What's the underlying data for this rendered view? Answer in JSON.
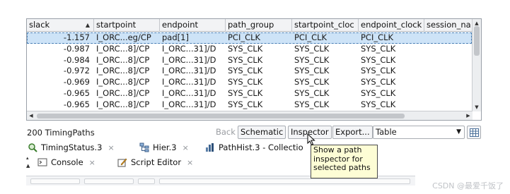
{
  "table": {
    "columns": [
      {
        "label": "slack",
        "width": 95
      },
      {
        "label": "startpoint",
        "width": 93
      },
      {
        "label": "endpoint",
        "width": 93
      },
      {
        "label": "path_group",
        "width": 94
      },
      {
        "label": "startpoint_cloc",
        "width": 94
      },
      {
        "label": "endpoint_clock",
        "width": 93
      },
      {
        "label": "session_na",
        "width": 67
      }
    ],
    "sorted_column": "slack",
    "sort_indicator": "^",
    "rows": [
      {
        "slack": "-1.157",
        "startpoint": "I_ORC...eg/CP",
        "endpoint": "pad[1]",
        "path_group": "PCI_CLK",
        "startpoint_clock": "PCI_CLK",
        "endpoint_clock": "PCI_CLK",
        "session": ""
      },
      {
        "slack": "-0.987",
        "startpoint": "I_ORC...8]/CP",
        "endpoint": "I_ORC...31]/D",
        "path_group": "SYS_CLK",
        "startpoint_clock": "SYS_CLK",
        "endpoint_clock": "SYS_CLK",
        "session": ""
      },
      {
        "slack": "-0.984",
        "startpoint": "I_ORC...8]/CP",
        "endpoint": "I_ORC...31]/D",
        "path_group": "SYS_CLK",
        "startpoint_clock": "SYS_CLK",
        "endpoint_clock": "SYS_CLK",
        "session": ""
      },
      {
        "slack": "-0.972",
        "startpoint": "I_ORC...8]/CP",
        "endpoint": "I_ORC...31]/D",
        "path_group": "SYS_CLK",
        "startpoint_clock": "SYS_CLK",
        "endpoint_clock": "SYS_CLK",
        "session": ""
      },
      {
        "slack": "-0.969",
        "startpoint": "I_ORC...8]/CP",
        "endpoint": "I_ORC...31]/D",
        "path_group": "SYS_CLK",
        "startpoint_clock": "SYS_CLK",
        "endpoint_clock": "SYS_CLK",
        "session": ""
      },
      {
        "slack": "-0.965",
        "startpoint": "I_ORC...8]/CP",
        "endpoint": "I_ORC...31]/D",
        "path_group": "SYS_CLK",
        "startpoint_clock": "SYS_CLK",
        "endpoint_clock": "SYS_CLK",
        "session": ""
      },
      {
        "slack": "-0.965",
        "startpoint": "I_ORC...8]/CP",
        "endpoint": "I_ORC...31]/D",
        "path_group": "SYS_CLK",
        "startpoint_clock": "SYS_CLK",
        "endpoint_clock": "SYS_CLK",
        "session": ""
      }
    ],
    "selected_row": 0
  },
  "toolbar": {
    "count_label": "200 TimingPaths",
    "back_label": "Back",
    "schematic_label": "Schematic",
    "inspector_label": "Inspector",
    "export_label": "Export...",
    "view_select_value": "Table",
    "view_caret": "▼"
  },
  "tabs_top": [
    {
      "label": "TimingStatus.3",
      "icon": "magnifier-icon"
    },
    {
      "label": "Hier.3",
      "icon": "hierarchy-icon"
    },
    {
      "label": "PathHist.3 - Collectio",
      "icon": "histogram-icon"
    }
  ],
  "tabs_bottom": [
    {
      "label": "Console",
      "icon": "console-icon"
    },
    {
      "label": "Script Editor",
      "icon": "script-editor-icon"
    }
  ],
  "close_glyph": "×",
  "tooltip": {
    "lines": [
      "Show a path",
      "inspector for",
      "selected paths"
    ]
  },
  "watermark": "CSDN @最爱千饭了",
  "colors": {
    "selected_row": "#cde3f7",
    "tooltip_bg": "#fdfdd5",
    "header_bg": "#f2f3f5"
  }
}
